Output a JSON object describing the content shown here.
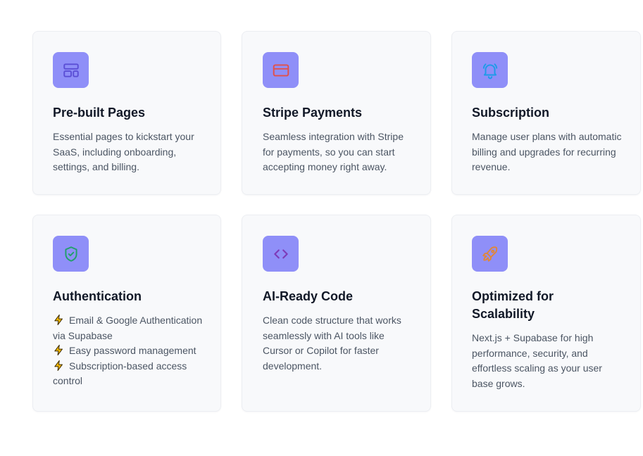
{
  "features": [
    {
      "icon": "layout-icon",
      "icon_color": "#5b4fd6",
      "title": "Pre-built Pages",
      "description": "Essential pages to kickstart your SaaS, including onboarding, settings, and billing."
    },
    {
      "icon": "credit-card-icon",
      "icon_color": "#e2504a",
      "title": "Stripe Payments",
      "description": "Seamless integration with Stripe for payments, so you can start accepting money right away."
    },
    {
      "icon": "bell-ring-icon",
      "icon_color": "#1e9be8",
      "title": "Subscription",
      "description": "Manage user plans with automatic billing and upgrades for recurring revenue."
    },
    {
      "icon": "shield-check-icon",
      "icon_color": "#22a06b",
      "title": "Authentication",
      "bullets": [
        "Email & Google Authentication via Supabase",
        "Easy password management",
        "Subscription-based access control"
      ]
    },
    {
      "icon": "code-icon",
      "icon_color": "#7e3bb8",
      "title": "AI-Ready Code",
      "description": "Clean code structure that works seamlessly with AI tools like Cursor or Copilot for faster development."
    },
    {
      "icon": "rocket-icon",
      "icon_color": "#e0863a",
      "title": "Optimized for Scalability",
      "description": "Next.js + Supabase for high performance, security, and effortless scaling as your user base grows."
    }
  ],
  "colors": {
    "icon_background": "#8f8ff8",
    "card_background": "#f8f9fb",
    "bullet_icon": "#f5b800"
  }
}
